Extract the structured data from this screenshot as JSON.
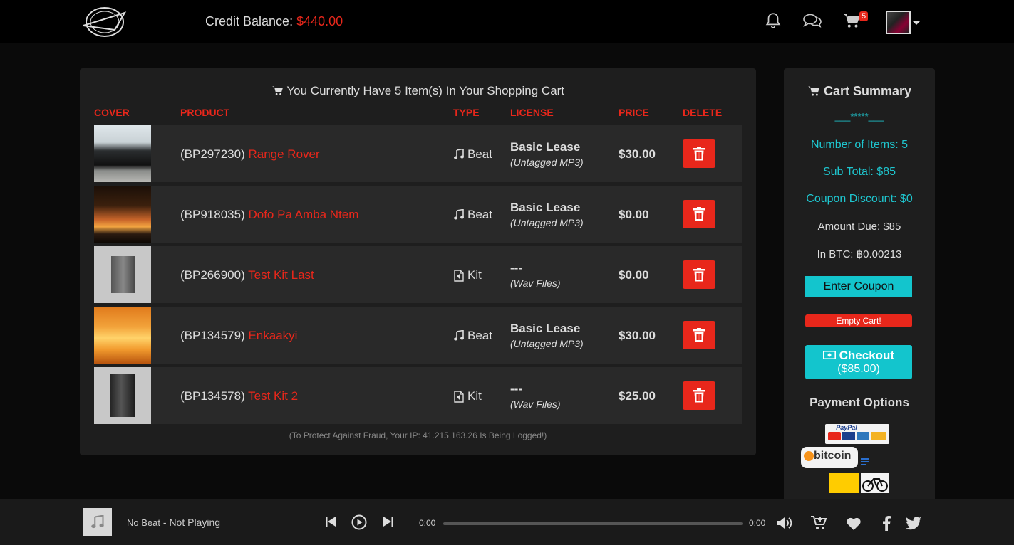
{
  "header": {
    "credit_label": "Credit Balance:",
    "credit_amount": "$440.00",
    "cart_count": "5"
  },
  "cart": {
    "title": "You Currently Have 5 Item(s) In Your Shopping Cart",
    "columns": {
      "cover": "COVER",
      "product": "PRODUCT",
      "type": "TYPE",
      "license": "LICENSE",
      "price": "PRICE",
      "delete": "DELETE"
    },
    "items": [
      {
        "code": "(BP297230)",
        "name": "Range Rover",
        "type": "Beat",
        "license": "Basic Lease",
        "license_sub": "(Untagged MP3)",
        "price": "$30.00"
      },
      {
        "code": "(BP918035)",
        "name": "Dofo Pa Amba Ntem",
        "type": "Beat",
        "license": "Basic Lease",
        "license_sub": "(Untagged MP3)",
        "price": "$0.00"
      },
      {
        "code": "(BP266900)",
        "name": "Test Kit Last",
        "type": "Kit",
        "license": "---",
        "license_sub": "(Wav Files)",
        "price": "$0.00"
      },
      {
        "code": "(BP134579)",
        "name": "Enkaakyi",
        "type": "Beat",
        "license": "Basic Lease",
        "license_sub": "(Untagged MP3)",
        "price": "$30.00"
      },
      {
        "code": "(BP134578)",
        "name": "Test Kit 2",
        "type": "Kit",
        "license": "---",
        "license_sub": "(Wav Files)",
        "price": "$25.00"
      }
    ],
    "fraud_notice": "(To Protect Against Fraud, Your IP: 41.215.163.26 Is Being Logged!)"
  },
  "summary": {
    "title": "Cart Summary",
    "stars": "___*****___",
    "items": "Number of Items: 5",
    "subtotal": "Sub Total: $85",
    "coupon_discount": "Coupon Discount: $0",
    "amount_due": "Amount Due: $85",
    "btc": "In BTC: ฿0.00213",
    "enter_coupon": "Enter Coupon",
    "empty_cart": "Empty Cart!",
    "checkout": "Checkout",
    "checkout_amount": "($85.00)",
    "payment_title": "Payment Options",
    "paypal_label": "PayPal",
    "bitcoin_label": "bitcoin"
  },
  "player": {
    "now_playing_beat": "No Beat",
    "now_playing_sep": " - ",
    "now_playing_status": "Not Playing",
    "time_current": "0:00",
    "time_total": "0:00",
    "progress": 0
  },
  "colors": {
    "accent_red": "#e8271b",
    "accent_cyan": "#13c5cd"
  }
}
